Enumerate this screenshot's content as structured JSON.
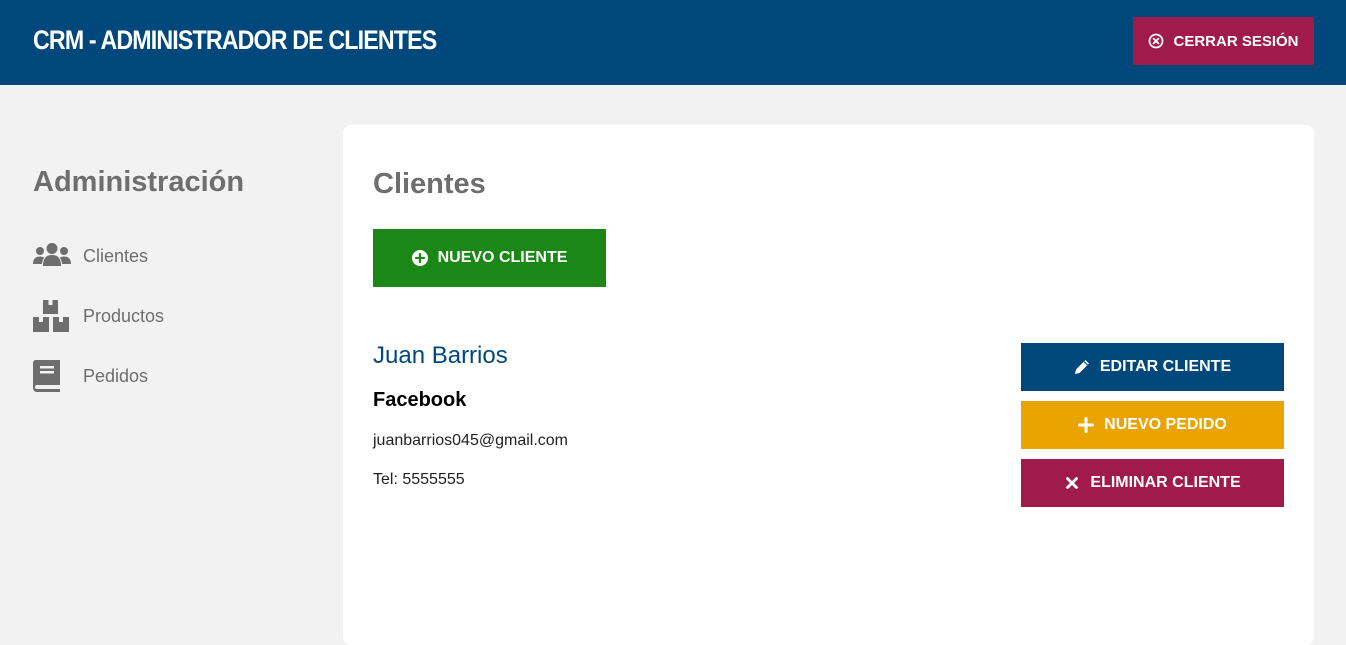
{
  "header": {
    "title": "CRM - ADMINISTRADOR DE CLIENTES",
    "logout_label": "CERRAR SESIÓN"
  },
  "sidebar": {
    "title": "Administración",
    "items": [
      {
        "label": "Clientes",
        "icon": "users-icon"
      },
      {
        "label": "Productos",
        "icon": "boxes-icon"
      },
      {
        "label": "Pedidos",
        "icon": "book-icon"
      }
    ]
  },
  "main": {
    "title": "Clientes",
    "new_client_label": "NUEVO CLIENTE",
    "client": {
      "name": "Juan Barrios",
      "company": "Facebook",
      "email": "juanbarrios045@gmail.com",
      "phone": "Tel: 5555555"
    },
    "actions": {
      "edit_label": "EDITAR CLIENTE",
      "new_order_label": "NUEVO PEDIDO",
      "delete_label": "ELIMINAR CLIENTE"
    }
  },
  "colors": {
    "primary": "#00487c",
    "danger": "#a01a4a",
    "success": "#1b8716",
    "warning": "#e9a400",
    "background": "#f2f2f2",
    "text_muted": "#6e6e6e"
  }
}
